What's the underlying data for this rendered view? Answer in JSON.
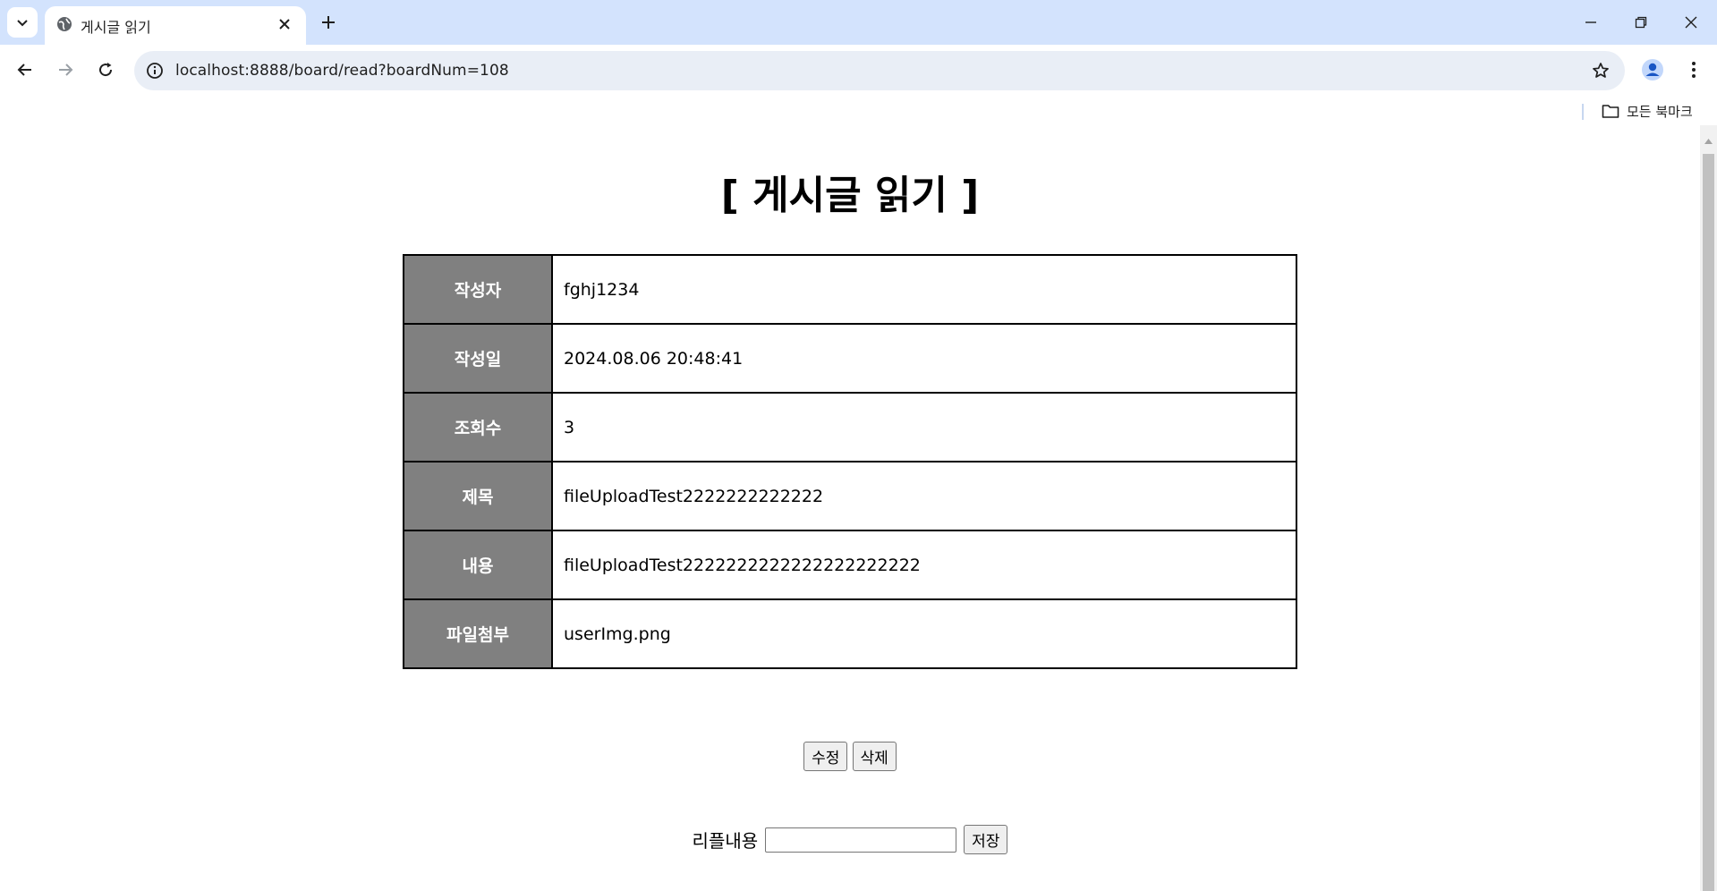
{
  "browser": {
    "tab_title": "게시글 읽기",
    "url": "localhost:8888/board/read?boardNum=108",
    "bookmarks_folder": "모든 북마크"
  },
  "page": {
    "title": "[ 게시글 읽기 ]",
    "rows": [
      {
        "label": "작성자",
        "value": "fghj1234"
      },
      {
        "label": "작성일",
        "value": "2024.08.06 20:48:41"
      },
      {
        "label": "조회수",
        "value": "3"
      },
      {
        "label": "제목",
        "value": "fileUploadTest2222222222222"
      },
      {
        "label": "내용",
        "value": "fileUploadTest2222222222222222222222"
      },
      {
        "label": "파일첨부",
        "value": "userImg.png"
      }
    ],
    "edit_button": "수정",
    "delete_button": "삭제",
    "reply_label": "리플내용",
    "reply_value": "",
    "save_button": "저장"
  },
  "colors": {
    "tabstrip_bg": "#d3e3fd",
    "omnibox_bg": "#e9eef6",
    "header_cell_bg": "#808080",
    "header_cell_text": "#ffffff"
  }
}
